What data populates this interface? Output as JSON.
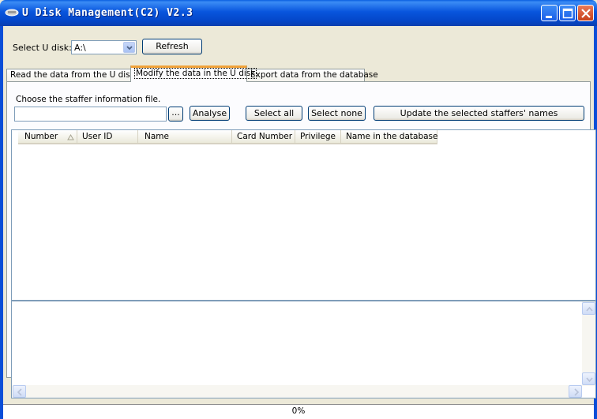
{
  "window": {
    "title": "U Disk Management(C2) V2.3",
    "titlebar_color": "#0a54e0",
    "buttons": [
      "minimize-icon",
      "maximize-icon",
      "close-icon"
    ]
  },
  "toolbar": {
    "select_label": "Select U disk:",
    "drive_value": "A:\\",
    "refresh_label": "Refresh"
  },
  "tabs": [
    {
      "label": "Read the data from the U disk",
      "active": false
    },
    {
      "label": "Modify the data in the U disk",
      "active": true
    },
    {
      "label": "Export data from the database",
      "active": false
    }
  ],
  "panel": {
    "file_label": "Choose the staffer information file.",
    "file_value": "",
    "browse_label": "...",
    "analyse_label": "Analyse",
    "select_all_label": "Select all",
    "select_none_label": "Select none",
    "update_label": "Update the selected staffers' names"
  },
  "table": {
    "columns": [
      "Number",
      "User ID",
      "Name",
      "Card Number",
      "Privilege",
      "Name in the database"
    ],
    "sort_icon": "sort-triangle-icon",
    "rows": []
  },
  "log": {
    "text": ""
  },
  "status": {
    "progress": "0%"
  }
}
